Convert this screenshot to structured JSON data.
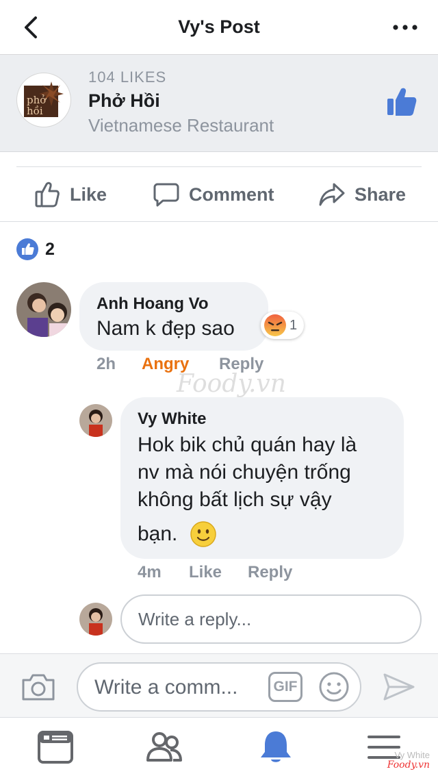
{
  "header": {
    "title": "Vy's Post"
  },
  "page": {
    "likes": "104 LIKES",
    "name": "Phở Hồi",
    "category": "Vietnamese Restaurant",
    "logo_text_line1": "phở",
    "logo_text_line2": "hồi"
  },
  "actions": {
    "like": "Like",
    "comment": "Comment",
    "share": "Share"
  },
  "reactions": {
    "count": "2"
  },
  "comment": {
    "author": "Anh Hoang Vo",
    "text": "Nam k đẹp sao",
    "reaction_count": "1",
    "time": "2h",
    "reaction_label": "Angry",
    "reply_label": "Reply"
  },
  "reply": {
    "author": "Vy White",
    "lines": [
      "Hok bik chủ quán hay là",
      "nv mà nói chuyện trống",
      "không bất lịch sự vậy",
      "bạn."
    ],
    "time": "4m",
    "like_label": "Like",
    "reply_label": "Reply"
  },
  "reply_box": {
    "placeholder": "Write a reply..."
  },
  "composer": {
    "placeholder": "Write a comm...",
    "gif": "GIF"
  },
  "watermark": {
    "center": "Foody.vn",
    "corner_user": "Vy White",
    "corner_brand": "Foody.vn"
  },
  "colors": {
    "accent": "#4b7bd6",
    "angry": "#e9710f",
    "muted": "#8d949e"
  }
}
